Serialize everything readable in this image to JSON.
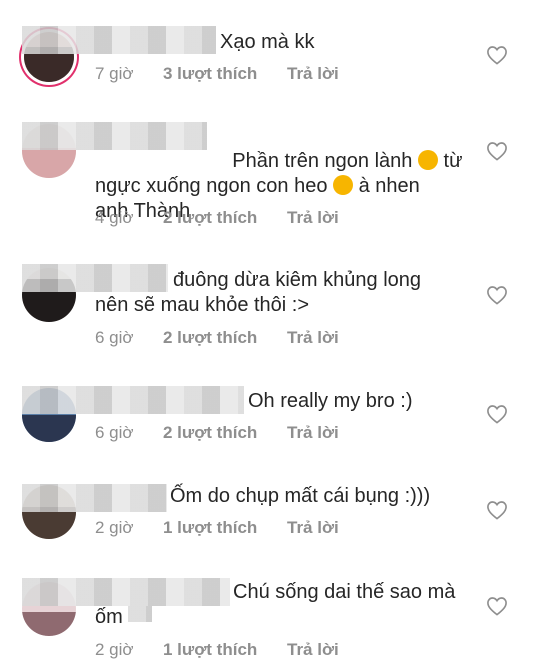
{
  "comments": [
    {
      "text": "Xạo mà kk",
      "time": "7 giờ",
      "likes": "3 lượt thích",
      "reply": "Trả lời"
    },
    {
      "text_a": "Phần trên ngon lành",
      "text_b": "từ",
      "text_c": "ngực xuống ngon con heo",
      "text_d": "à nhen",
      "text_e": "anh Thành",
      "time": "4 giờ",
      "likes": "2 lượt thích",
      "reply": "Trả lời"
    },
    {
      "text": "đuông dừa kiêm khủng long\nnên sẽ mau khỏe thôi :>",
      "time": "6 giờ",
      "likes": "2 lượt thích",
      "reply": "Trả lời"
    },
    {
      "text": "Oh really my bro :)",
      "time": "6 giờ",
      "likes": "2 lượt thích",
      "reply": "Trả lời"
    },
    {
      "text": "Ốm do chụp mất cái bụng :)))",
      "time": "2 giờ",
      "likes": "1 lượt thích",
      "reply": "Trả lời"
    },
    {
      "text": "Chú sống dai thế sao mà\nốm",
      "time": "2 giờ",
      "likes": "1 lượt thích",
      "reply": "Trả lời"
    }
  ],
  "icons": {
    "heart": "heart-outline-icon",
    "emoji_1": "smiling-face-icon",
    "emoji_2": "grinning-face-icon"
  },
  "colors": {
    "text": "#262626",
    "meta": "#8e8e8e",
    "story_ring": "#e1306c"
  }
}
